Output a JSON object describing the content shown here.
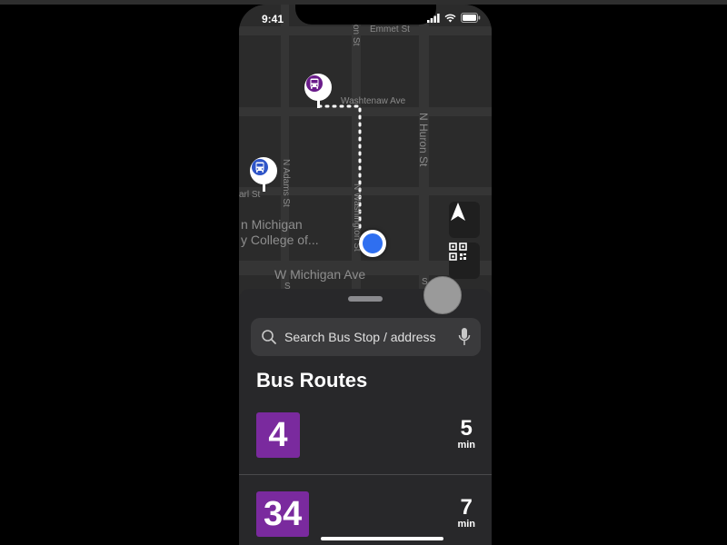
{
  "status_bar": {
    "time": "9:41"
  },
  "map": {
    "streets": {
      "emmet": "Emmet St",
      "ashley": "on St",
      "washtenaw": "Washtenaw Ave",
      "n_huron": "N Huron St",
      "n_adams": "N Adams St",
      "n_washington": "N Washington St",
      "earl": "arl St",
      "w_michigan": "W Michigan Ave",
      "s_a": "S",
      "s_b": "S"
    },
    "poi": {
      "line1": "n Michigan",
      "line2": "y College of..."
    }
  },
  "search": {
    "placeholder": "Search Bus Stop / address"
  },
  "section": {
    "title": "Bus Routes"
  },
  "routes": [
    {
      "number": "4",
      "eta": "5",
      "unit": "min",
      "color": "#7a2a9e"
    },
    {
      "number": "34",
      "eta": "7",
      "unit": "min",
      "color": "#7a2a9e"
    }
  ],
  "colors": {
    "accent": "#2f6ff0",
    "route": "#7a2a9e",
    "bus_pin_purple": "#6a1b8a",
    "bus_pin_blue": "#2f55c8"
  },
  "icons": {
    "bus": "bus-icon",
    "location": "location-arrow-icon",
    "qr": "qr-code-icon",
    "search": "search-icon",
    "mic": "microphone-icon"
  }
}
